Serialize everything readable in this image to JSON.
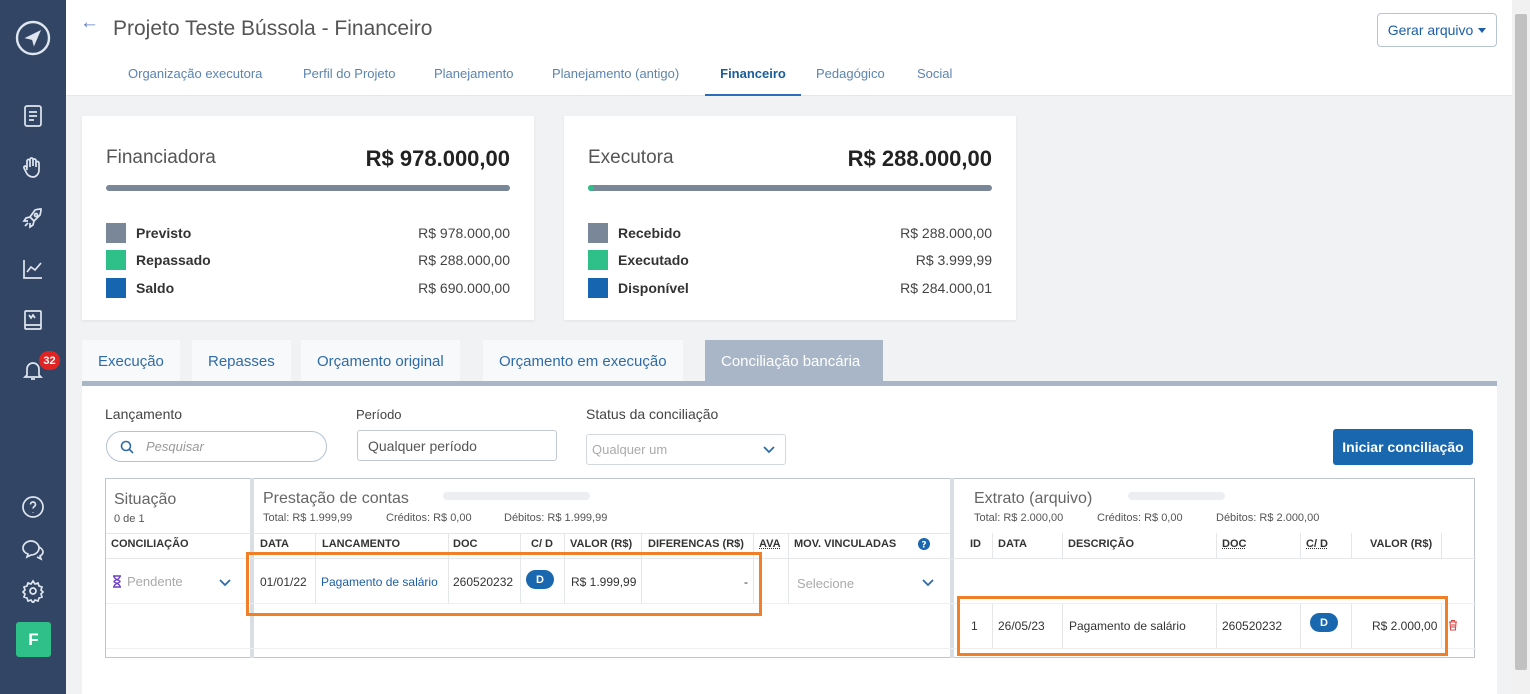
{
  "header": {
    "title": "Projeto Teste Bússola - Financeiro",
    "gerar": "Gerar arquivo"
  },
  "nav_tabs": [
    "Organização executora",
    "Perfil do Projeto",
    "Planejamento",
    "Planejamento (antigo)",
    "Financeiro",
    "Pedagógico",
    "Social"
  ],
  "sidebar": {
    "notif_count": "32",
    "avatar": "F"
  },
  "cards": [
    {
      "title": "Financiadora",
      "total": "R$ 978.000,00",
      "progress": 0,
      "rows": [
        {
          "label": "Previsto",
          "value": "R$ 978.000,00",
          "color": "#7a8799"
        },
        {
          "label": "Repassado",
          "value": "R$ 288.000,00",
          "color": "#2fbf88"
        },
        {
          "label": "Saldo",
          "value": "R$ 690.000,00",
          "color": "#1665b0"
        }
      ]
    },
    {
      "title": "Executora",
      "total": "R$ 288.000,00",
      "progress": 0.014,
      "rows": [
        {
          "label": "Recebido",
          "value": "R$ 288.000,00",
          "color": "#7a8799"
        },
        {
          "label": "Executado",
          "value": "R$ 3.999,99",
          "color": "#2fbf88"
        },
        {
          "label": "Disponível",
          "value": "R$ 284.000,01",
          "color": "#1665b0"
        }
      ]
    }
  ],
  "sub_tabs": [
    "Execução",
    "Repasses",
    "Orçamento original",
    "Orçamento em execução",
    "Conciliação bancária"
  ],
  "filters": {
    "lancamento_label": "Lançamento",
    "search_placeholder": "Pesquisar",
    "periodo_label": "Período",
    "periodo_value": "Qualquer período",
    "status_label": "Status da conciliação",
    "status_value": "Qualquer um",
    "iniciar": "Iniciar conciliação"
  },
  "situacao": {
    "title": "Situação",
    "count": "0 de 1",
    "col": "CONCILIAÇÃO",
    "status": "Pendente"
  },
  "prestacao": {
    "title": "Prestação de contas",
    "total": "Total: R$ 1.999,99",
    "creditos": "Créditos: R$ 0,00",
    "debitos": "Débitos: R$ 1.999,99",
    "cols": [
      "DATA",
      "LANCAMENTO",
      "DOC",
      "C/ D",
      "VALOR (R$)",
      "DIFERENCAS (R$)",
      "AVA",
      "MOV. VINCULADAS"
    ],
    "row": {
      "data": "01/01/22",
      "lancamento": "Pagamento de salário",
      "doc": "260520232",
      "cd": "D",
      "valor": "R$ 1.999,99",
      "dif": "-",
      "select": "Selecione"
    }
  },
  "extrato": {
    "title": "Extrato (arquivo)",
    "total": "Total: R$ 2.000,00",
    "creditos": "Créditos: R$ 0,00",
    "debitos": "Débitos: R$ 2.000,00",
    "cols": [
      "ID",
      "DATA",
      "DESCRIÇÃO",
      "DOC",
      "C/ D",
      "VALOR (R$)"
    ],
    "row": {
      "id": "1",
      "data": "26/05/23",
      "descricao": "Pagamento de salário",
      "doc": "260520232",
      "cd": "D",
      "valor": "R$ 2.000,00"
    }
  }
}
